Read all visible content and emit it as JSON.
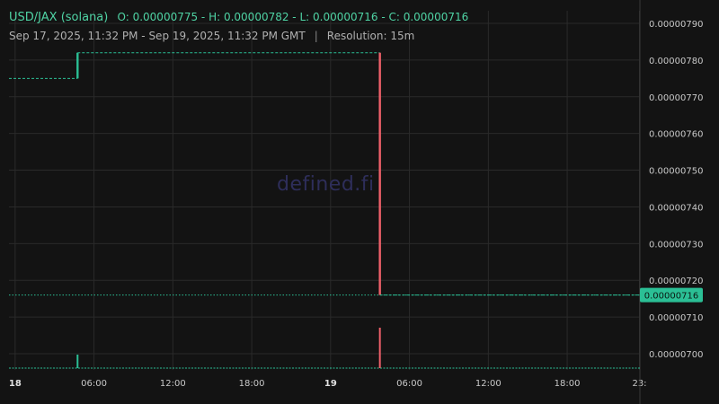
{
  "header": {
    "pair": "USD/JAX (solana)",
    "ohlc": "O: 0.00000775 - H: 0.00000782 - L: 0.00000716 - C: 0.00000716",
    "range": "Sep 17, 2025, 11:32 PM - Sep 19, 2025, 11:32 PM GMT",
    "separator": "|",
    "resolution": "Resolution: 15m"
  },
  "watermark": "defined.fi",
  "colors": {
    "background": "#131313",
    "grid": "#2a2a2a",
    "up": "#2bbf95",
    "down": "#f0606a",
    "price_tag": "#2bbf95",
    "text": "#c9c9c9"
  },
  "chart_data": {
    "type": "candlestick",
    "title": "USD/JAX (solana)",
    "resolution": "15m",
    "x_time_range": [
      "2025-09-17T23:32:00Z",
      "2025-09-19T23:32:00Z"
    ],
    "x_ticks": [
      {
        "label": "18",
        "time": "2025-09-18T00:00",
        "bold": true
      },
      {
        "label": "06:00",
        "time": "2025-09-18T06:00",
        "bold": false
      },
      {
        "label": "12:00",
        "time": "2025-09-18T12:00",
        "bold": false
      },
      {
        "label": "18:00",
        "time": "2025-09-18T18:00",
        "bold": false
      },
      {
        "label": "19",
        "time": "2025-09-19T00:00",
        "bold": true
      },
      {
        "label": "06:00",
        "time": "2025-09-19T06:00",
        "bold": false
      },
      {
        "label": "12:00",
        "time": "2025-09-19T12:00",
        "bold": false
      },
      {
        "label": "18:00",
        "time": "2025-09-19T18:00",
        "bold": false
      },
      {
        "label": "23:",
        "time": "2025-09-19T23:30",
        "bold": false
      }
    ],
    "y_ticks": [
      {
        "label": "0.00000790",
        "value": 7.9e-06
      },
      {
        "label": "0.00000780",
        "value": 7.8e-06
      },
      {
        "label": "0.00000770",
        "value": 7.7e-06
      },
      {
        "label": "0.00000760",
        "value": 7.6e-06
      },
      {
        "label": "0.00000750",
        "value": 7.5e-06
      },
      {
        "label": "0.00000740",
        "value": 7.4e-06
      },
      {
        "label": "0.00000730",
        "value": 7.3e-06
      },
      {
        "label": "0.00000720",
        "value": 7.2e-06
      },
      {
        "label": "0.00000710",
        "value": 7.1e-06
      },
      {
        "label": "0.00000700",
        "value": 7e-06
      }
    ],
    "ylim": [
      6.95e-06,
      7.93e-06
    ],
    "last_price": {
      "label": "0.00000716",
      "value": 7.16e-06
    },
    "price_segments": [
      {
        "start": "2025-09-17T23:32",
        "end": "2025-09-18T04:45",
        "price": 7.75e-06
      },
      {
        "start": "2025-09-18T04:45",
        "end": "2025-09-19T03:45",
        "price": 7.82e-06
      },
      {
        "start": "2025-09-19T03:45",
        "end": "2025-09-19T23:32",
        "price": 7.16e-06
      }
    ],
    "candles": [
      {
        "time": "2025-09-18T04:45",
        "open": 7.75e-06,
        "close": 7.82e-06,
        "direction": "up"
      },
      {
        "time": "2025-09-19T03:45",
        "open": 7.82e-06,
        "close": 7.16e-06,
        "direction": "down"
      }
    ],
    "volume": [
      {
        "time": "2025-09-18T04:45",
        "level": 0.25,
        "direction": "up"
      },
      {
        "time": "2025-09-19T03:45",
        "level": 0.75,
        "direction": "down"
      }
    ]
  }
}
